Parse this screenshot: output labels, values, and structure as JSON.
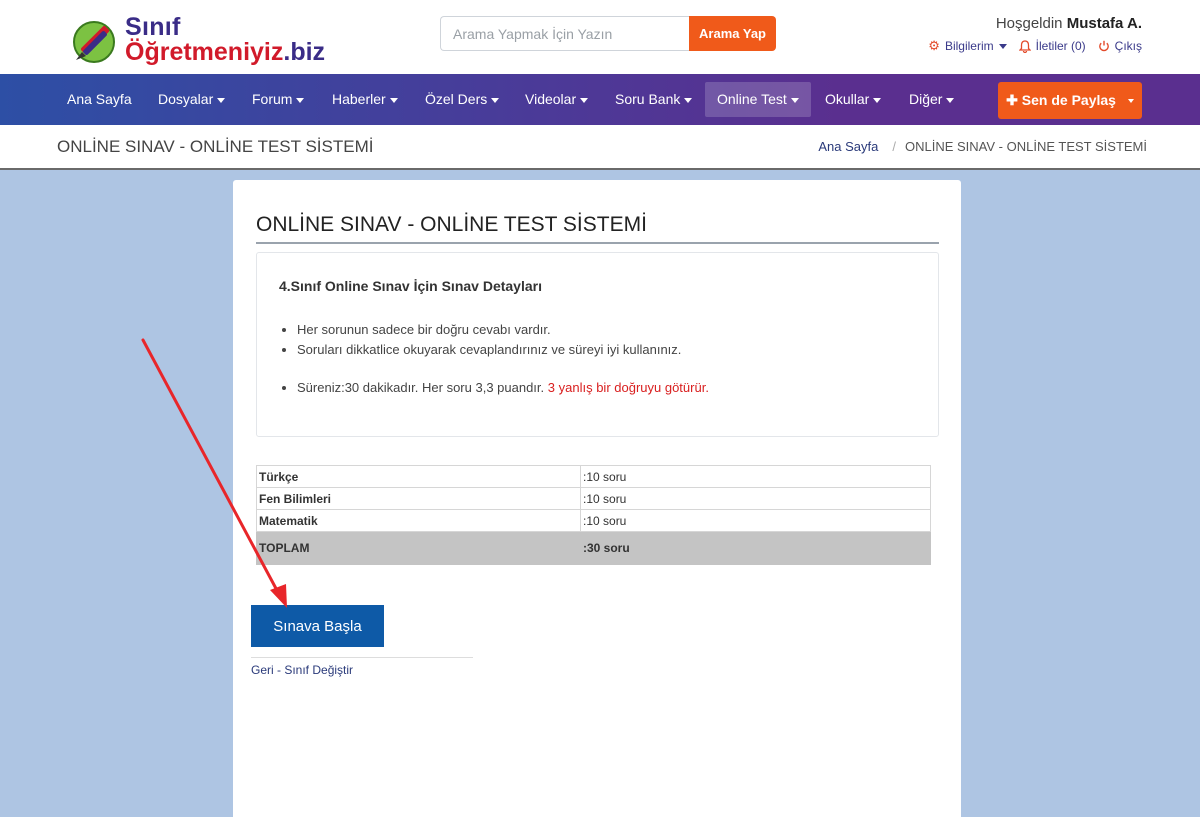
{
  "brand": {
    "line1": "Sınıf",
    "line2_main": "Öğretmeniyiz",
    "line2_tld": ".biz"
  },
  "search": {
    "placeholder": "Arama Yapmak İçin Yazın",
    "button": "Arama Yap"
  },
  "user": {
    "greeting": "Hoşgeldin",
    "name": "Mustafa A.",
    "menu": {
      "profile": "Bilgilerim",
      "messages": "İletiler (0)",
      "logout": "Çıkış"
    }
  },
  "nav": {
    "items": [
      "Ana Sayfa",
      "Dosyalar",
      "Forum",
      "Haberler",
      "Özel Ders",
      "Videolar",
      "Soru Bank",
      "Online Test",
      "Okullar",
      "Diğer"
    ],
    "share": "Sen de Paylaş"
  },
  "breadcrumb": {
    "title": "ONLİNE SINAV - ONLİNE TEST SİSTEMİ",
    "home": "Ana Sayfa",
    "current": "ONLİNE SINAV - ONLİNE TEST SİSTEMİ"
  },
  "main": {
    "title": "ONLİNE SINAV - ONLİNE TEST SİSTEMİ",
    "panel_title": "4.Sınıf Online Sınav İçin Sınav Detayları",
    "rules": [
      "Her sorunun sadece bir doğru cevabı vardır.",
      "Soruları dikkatlice okuyarak cevaplandırınız ve süreyi iyi kullanınız."
    ],
    "duration_text": "Süreniz:30 dakikadır. Her soru 3,3 puandır.",
    "penalty_text": "3 yanlış bir doğruyu götürür.",
    "table": [
      {
        "subject": "Türkçe",
        "count": ":10 soru"
      },
      {
        "subject": "Fen Bilimleri",
        "count": ":10 soru"
      },
      {
        "subject": "Matematik",
        "count": ":10 soru"
      }
    ],
    "total": {
      "label": "TOPLAM",
      "count": ":30 soru"
    },
    "start_button": "Sınava Başla",
    "back_link": "Geri - Sınıf Değiştir"
  },
  "colors": {
    "accent": "#f05a1a",
    "primary": "#0e5aa7",
    "page_bg": "#aec5e3",
    "annotation": "#e8262a"
  }
}
